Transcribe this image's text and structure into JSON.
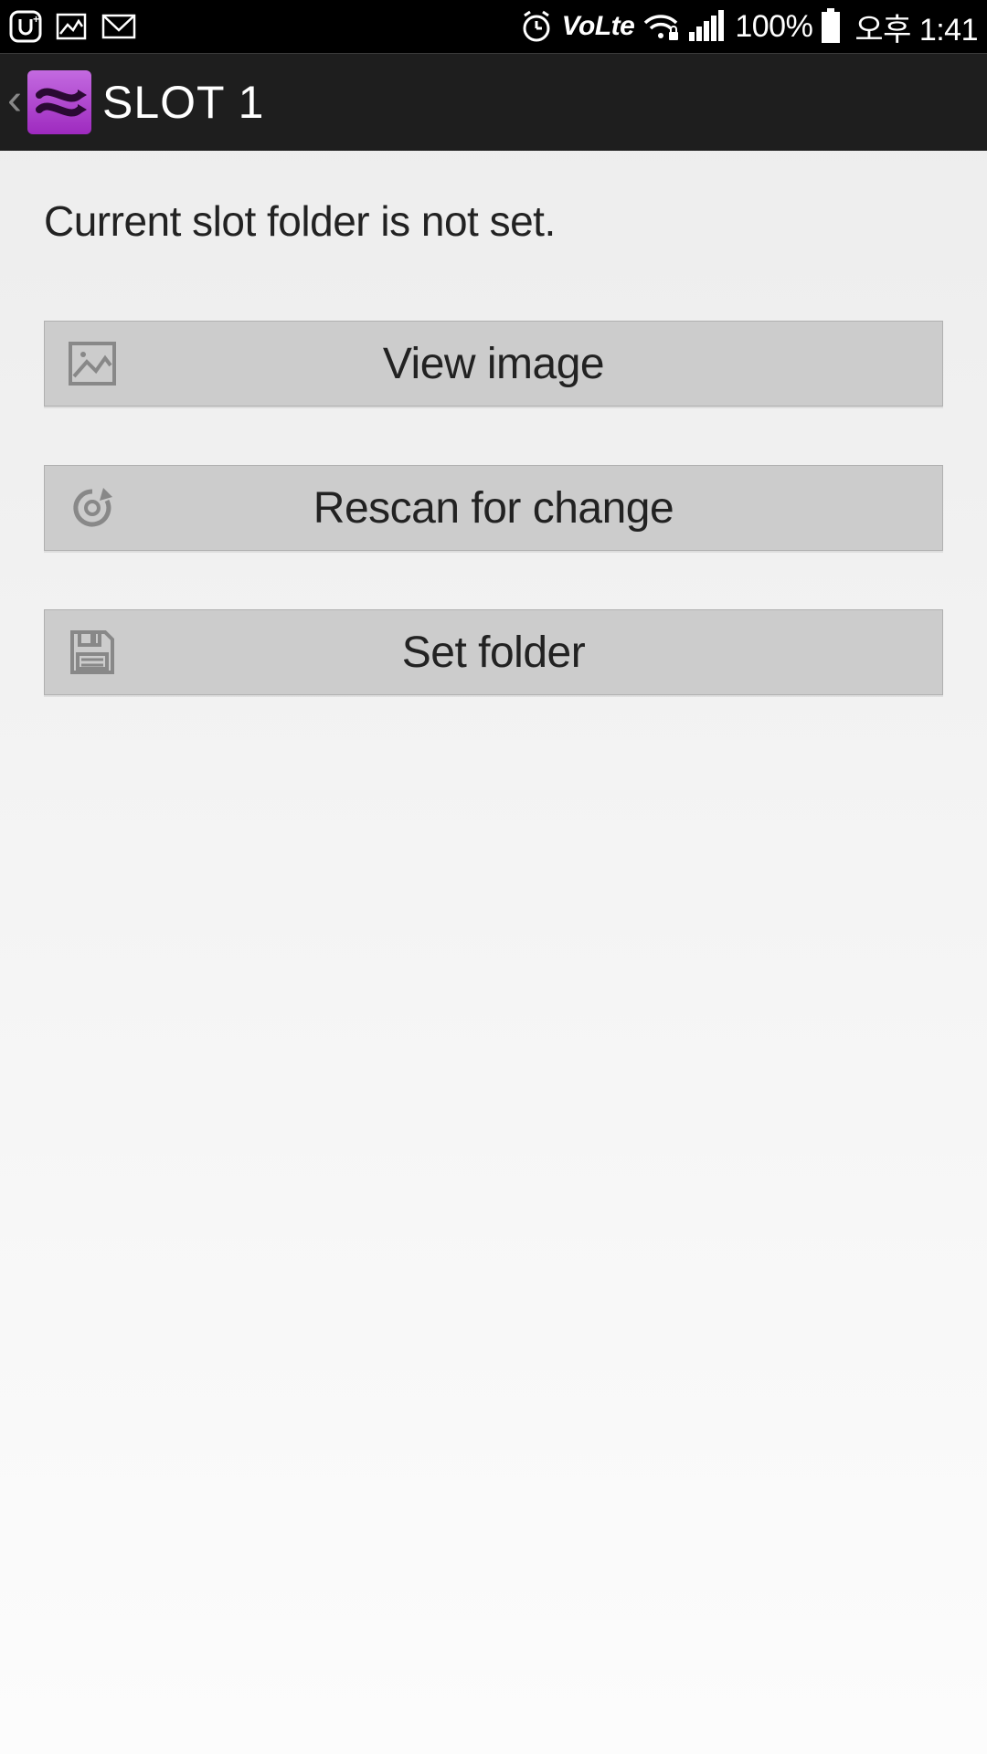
{
  "status_bar": {
    "carrier_icon": "U+",
    "gallery_icon": "gallery",
    "gmail_icon": "gmail",
    "alarm_icon": "alarm",
    "volte_label": "VoLte",
    "wifi_icon": "wifi-lock",
    "signal_icon": "signal-full",
    "battery_pct": "100%",
    "battery_icon": "battery-full",
    "time": "오후 1:41"
  },
  "app_bar": {
    "back_caret": "‹",
    "title": "SLOT 1"
  },
  "main": {
    "status_message": "Current slot folder is not set.",
    "buttons": [
      {
        "icon": "image-icon",
        "label": "View image"
      },
      {
        "icon": "rescan-icon",
        "label": "Rescan for change"
      },
      {
        "icon": "save-icon",
        "label": "Set folder"
      }
    ]
  }
}
